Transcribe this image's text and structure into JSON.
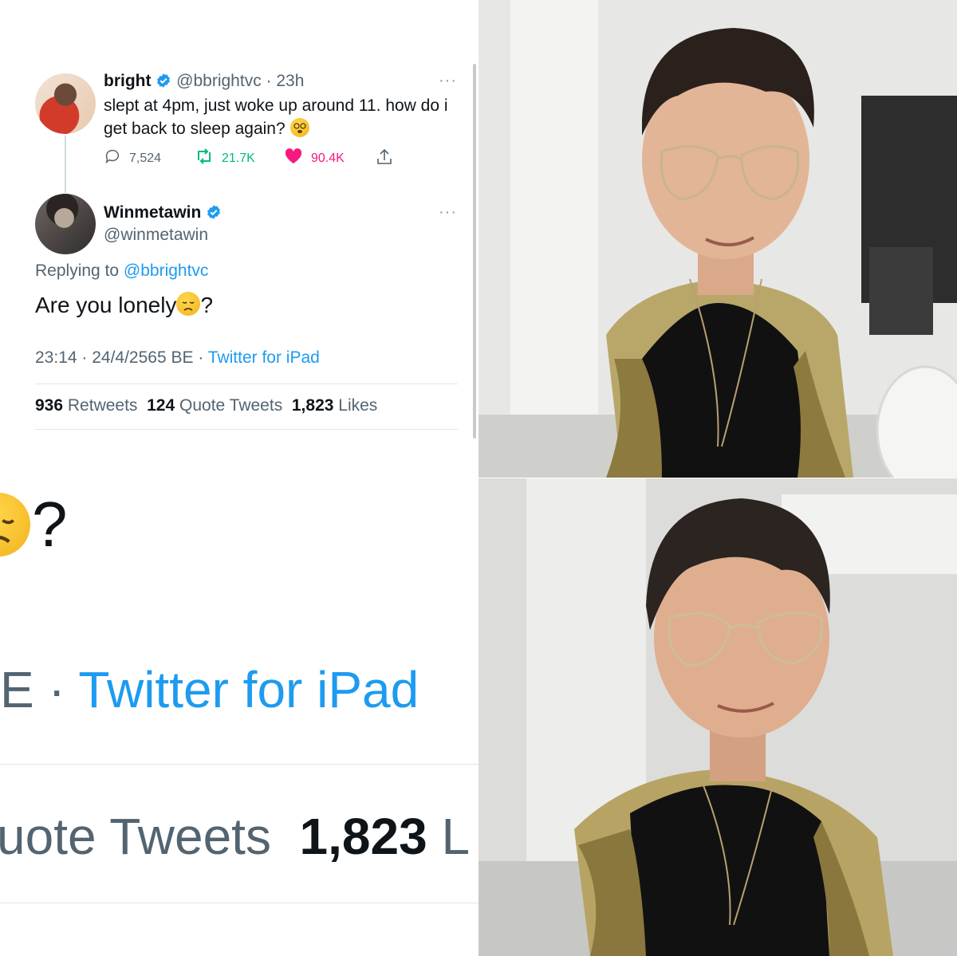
{
  "tweet_parent": {
    "name": "bright",
    "handle": "@bbrightvc",
    "time": "· 23h",
    "text": "slept at 4pm, just woke up around 11. how do i get back to sleep again?",
    "replies": "7,524",
    "retweets": "21.7K",
    "likes": "90.4K",
    "more": "···"
  },
  "tweet_main": {
    "name": "Winmetawin",
    "handle": "@winmetawin",
    "more": "···",
    "replying_label": "Replying to",
    "replying_handle": "@bbrightvc",
    "text": "Are you lonely",
    "text_suffix": "?",
    "timestamp": "23:14 · 24/4/2565 BE ·",
    "source": "Twitter for iPad",
    "stats": {
      "retweets_count": "936",
      "retweets_label": "Retweets",
      "quotes_count": "124",
      "quotes_label": "Quote Tweets",
      "likes_count": "1,823",
      "likes_label": "Likes"
    }
  },
  "zoom": {
    "question": "?",
    "meta_prefix": "E ·",
    "source": "Twitter for iPad",
    "quotes_label": "uote Tweets",
    "likes_count": "1,823",
    "likes_partial": "L"
  },
  "colors": {
    "link": "#1d9bf0",
    "retweet": "#00ba7c",
    "like": "#f91880",
    "muted": "#536471"
  }
}
